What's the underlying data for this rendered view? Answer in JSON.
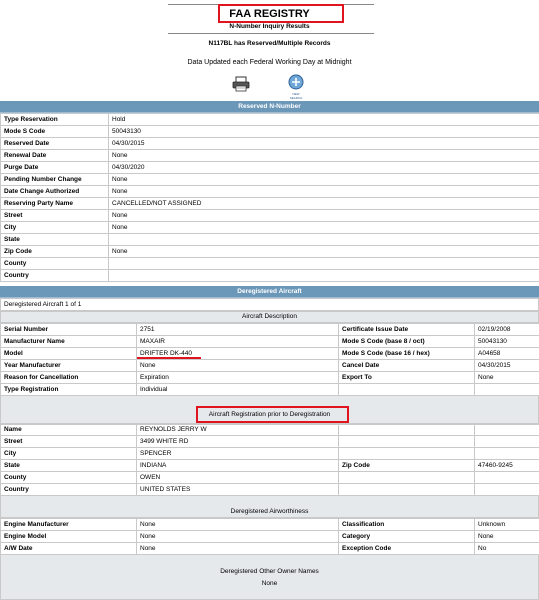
{
  "header": {
    "title": "FAA REGISTRY",
    "subtitle": "N-Number Inquiry Results",
    "status": "N117BL has Reserved/Multiple Records",
    "update_note": "Data Updated each Federal Working Day at Midnight",
    "print_icon": "printer-icon",
    "search_icon": "new-search-icon",
    "search_icon_text": "NEW SEARCH"
  },
  "reserved": {
    "section_title": "Reserved N-Number",
    "rows": [
      {
        "label": "Type Reservation",
        "value": "Hold"
      },
      {
        "label": "Mode S Code",
        "value": "50043130"
      },
      {
        "label": "Reserved Date",
        "value": "04/30/2015"
      },
      {
        "label": "Renewal Date",
        "value": "None"
      },
      {
        "label": "Purge Date",
        "value": "04/30/2020"
      },
      {
        "label": "Pending Number Change",
        "value": "None"
      },
      {
        "label": "Date Change Authorized",
        "value": "None"
      },
      {
        "label": "Reserving Party Name",
        "value": "CANCELLED/NOT ASSIGNED"
      },
      {
        "label": "Street",
        "value": "None"
      },
      {
        "label": "City",
        "value": "None"
      },
      {
        "label": "State",
        "value": ""
      },
      {
        "label": "Zip Code",
        "value": "None"
      },
      {
        "label": "County",
        "value": ""
      },
      {
        "label": "Country",
        "value": ""
      }
    ]
  },
  "deregistered": {
    "section_title": "Deregistered Aircraft",
    "count_text": "Deregistered Aircraft 1 of 1",
    "aircraft_description": {
      "title": "Aircraft Description",
      "rows": [
        {
          "l1": "Serial Number",
          "v1": "2751",
          "l2": "Certificate Issue Date",
          "v2": "02/19/2008"
        },
        {
          "l1": "Manufacturer Name",
          "v1": "MAXAIR",
          "l2": "Mode S Code (base 8 / oct)",
          "v2": "50043130"
        },
        {
          "l1": "Model",
          "v1": "DRIFTER DK-440",
          "l2": "Mode S Code (base 16 / hex)",
          "v2": "A04658"
        },
        {
          "l1": "Year Manufacturer",
          "v1": "None",
          "l2": "Cancel Date",
          "v2": "04/30/2015"
        },
        {
          "l1": "Reason for Cancellation",
          "v1": "Expiration",
          "l2": "Export To",
          "v2": "None"
        },
        {
          "l1": "Type Registration",
          "v1": "Individual",
          "l2": "",
          "v2": ""
        }
      ]
    },
    "prior_registration": {
      "title": "Aircraft Registration prior to Deregistration",
      "rows": [
        {
          "l1": "Name",
          "v1": "REYNOLDS JERRY W",
          "l2": "",
          "v2": ""
        },
        {
          "l1": "Street",
          "v1": "3499 WHITE RD",
          "l2": "",
          "v2": ""
        },
        {
          "l1": "City",
          "v1": "SPENCER",
          "l2": "",
          "v2": ""
        },
        {
          "l1": "State",
          "v1": "INDIANA",
          "l2": "Zip Code",
          "v2": "47460-9245"
        },
        {
          "l1": "County",
          "v1": "OWEN",
          "l2": "",
          "v2": ""
        },
        {
          "l1": "Country",
          "v1": "UNITED STATES",
          "l2": "",
          "v2": ""
        }
      ]
    },
    "airworthiness": {
      "title": "Deregistered Airworthiness",
      "rows": [
        {
          "l1": "Engine Manufacturer",
          "v1": "None",
          "l2": "Classification",
          "v2": "Unknown"
        },
        {
          "l1": "Engine Model",
          "v1": "None",
          "l2": "Category",
          "v2": "None"
        },
        {
          "l1": "A/W Date",
          "v1": "None",
          "l2": "Exception Code",
          "v2": "No"
        }
      ]
    },
    "other_owners": {
      "title": "Deregistered Other Owner Names",
      "value": "None"
    }
  },
  "colors": {
    "section_bar": "#6b97b9",
    "highlight": "#e0141e",
    "grey_band": "#e6e9ec"
  }
}
